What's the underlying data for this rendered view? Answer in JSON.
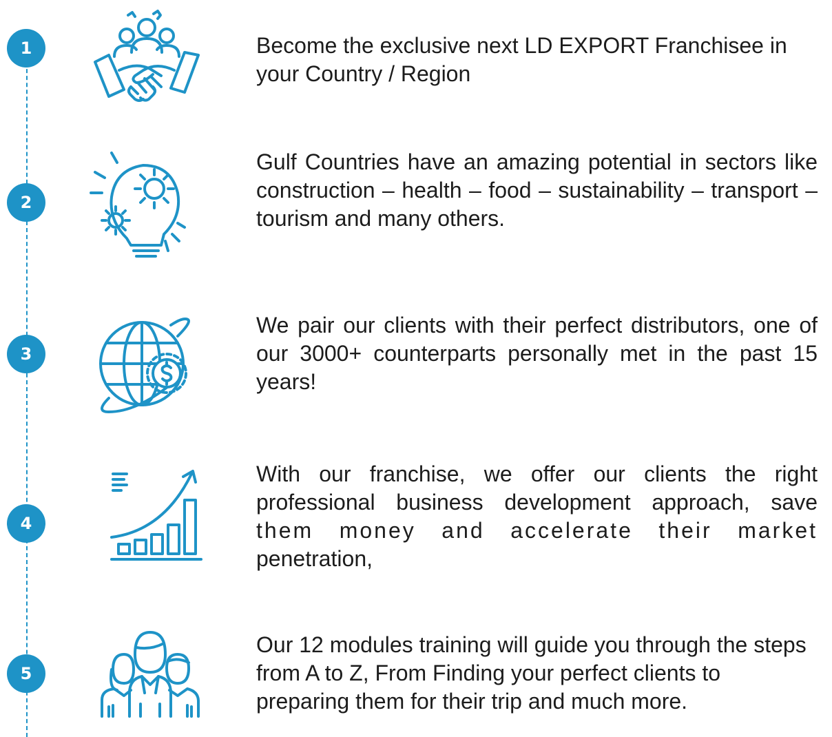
{
  "steps": [
    {
      "number": "1",
      "icon": "handshake-team-icon",
      "text": "Become the exclusive next LD EXPORT Franchisee in your Country / Region"
    },
    {
      "number": "2",
      "icon": "lightbulb-gears-icon",
      "text": "Gulf Countries have an amazing potential in sectors like construction – health – food – sustainability – transport – tourism and many others."
    },
    {
      "number": "3",
      "icon": "globe-dollar-icon",
      "text": "We pair our clients with their perfect distributors, one of our 3000+ counterparts personally met in the past 15 years!"
    },
    {
      "number": "4",
      "icon": "growth-chart-icon",
      "text_lines": [
        "With our franchise, we offer our clients the right",
        "professional business development approach, save",
        "them money and accelerate their market",
        "penetration,"
      ]
    },
    {
      "number": "5",
      "icon": "team-people-icon",
      "text": "Our 12 modules training will guide you through the steps from A to Z, From Finding your perfect clients to preparing them for their trip and much more."
    }
  ],
  "colors": {
    "accent": "#1e93c7",
    "text": "#1c1c1c"
  }
}
